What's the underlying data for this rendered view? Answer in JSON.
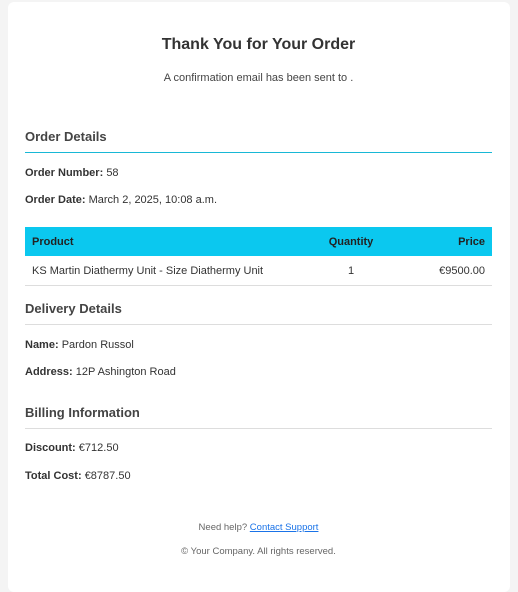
{
  "header": {
    "title": "Thank You for Your Order",
    "subtitle": "A confirmation email has been sent to ."
  },
  "order_details": {
    "heading": "Order Details",
    "order_number_label": "Order Number:",
    "order_number": "58",
    "order_date_label": "Order Date:",
    "order_date": "March 2, 2025, 10:08 a.m."
  },
  "items_table": {
    "columns": [
      "Product",
      "Quantity",
      "Price"
    ],
    "rows": [
      {
        "product": "KS Martin Diathermy Unit - Size Diathermy Unit",
        "quantity": "1",
        "price": "€9500.00"
      }
    ]
  },
  "delivery": {
    "heading": "Delivery Details",
    "name_label": "Name:",
    "name": "Pardon Russol",
    "address_label": "Address:",
    "address": "12P Ashington Road"
  },
  "billing": {
    "heading": "Billing Information",
    "discount_label": "Discount:",
    "discount": "€712.50",
    "total_label": "Total Cost:",
    "total": "€8787.50"
  },
  "footer": {
    "help_text": "Need help?",
    "support_link": "Contact Support",
    "copyright": "© Your Company. All rights reserved."
  },
  "colors": {
    "accent": "#0bc8ef",
    "link": "#1a73e8"
  }
}
